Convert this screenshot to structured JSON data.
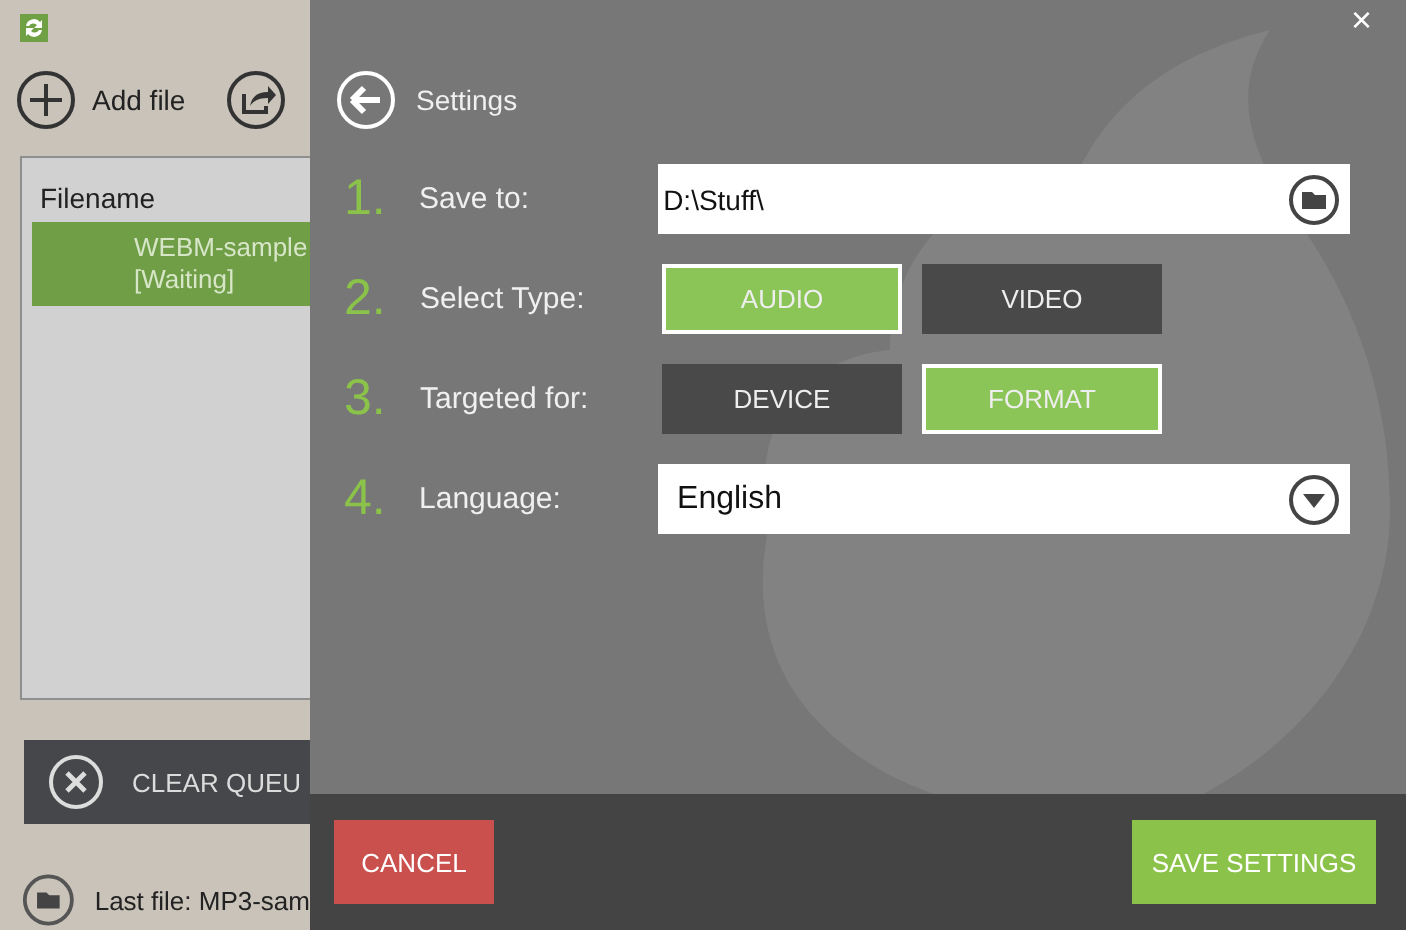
{
  "toolbar": [
    {
      "kind": "add",
      "label": "Add file"
    },
    {
      "kind": "share"
    }
  ],
  "queue": {
    "columns": [
      "Filename"
    ],
    "rows": [
      {
        "name": "WEBM-sample",
        "status": "[Waiting]",
        "selected": true
      }
    ]
  },
  "clear_button": "CLEAR QUEU",
  "last_file": "Last file: MP3-sam",
  "settings": {
    "title": "Settings",
    "close": "×",
    "rows": [
      {
        "number": "1.",
        "label": "Save to:",
        "kind": "path",
        "value": "D:\\Stuff\\"
      },
      {
        "number": "2.",
        "label": "Select Type:",
        "kind": "choice",
        "options": [
          {
            "label": "AUDIO",
            "selected": true
          },
          {
            "label": "VIDEO",
            "selected": false
          }
        ]
      },
      {
        "number": "3.",
        "label": "Targeted for:",
        "kind": "choice",
        "options": [
          {
            "label": "DEVICE",
            "selected": false
          },
          {
            "label": "FORMAT",
            "selected": true
          }
        ]
      },
      {
        "number": "4.",
        "label": "Language:",
        "kind": "dropdown",
        "value": "English"
      }
    ]
  },
  "footer": {
    "cancel": "CANCEL",
    "save": "SAVE SETTINGS"
  }
}
